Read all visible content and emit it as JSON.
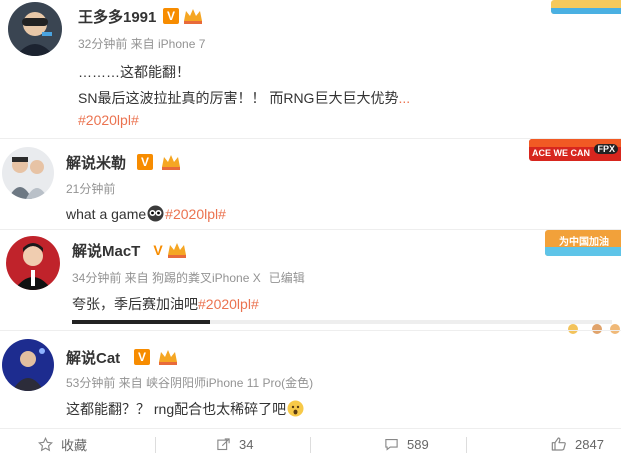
{
  "posts": [
    {
      "username": "王多多1991",
      "meta": "32分钟前 来自 iPhone 7",
      "lines": [
        "………这都能翻！",
        "SN最后这波拉扯真的厉害！！ 而RNG巨大巨大优势"
      ],
      "ellipsis": "...",
      "tag": "#2020lpl#"
    },
    {
      "username": "解说米勒",
      "meta": "21分钟前",
      "text": "what a game",
      "tag": "#2020lpl#",
      "banner_text": "ACE WE CAN",
      "banner_logo": "FPX"
    },
    {
      "username": "解说MacT",
      "meta": "34分钟前 来自 狗踢的粪叉iPhone X",
      "edited": "已编辑",
      "text": "夸张，季后赛加油吧",
      "tag": "#2020lpl#",
      "banner_text": "为中国加油"
    },
    {
      "username": "解说Cat",
      "meta": "53分钟前 来自 峡谷阴阳师iPhone 11 Pro(金色)",
      "text": "这都能翻？？ rng配合也太稀碎了吧"
    }
  ],
  "actions": {
    "favorite": "收藏",
    "repost": "34",
    "comment": "589",
    "like": "2847"
  },
  "colors": {
    "tag": "#eb7350",
    "meta": "#939393",
    "vip": "#f78c00"
  }
}
